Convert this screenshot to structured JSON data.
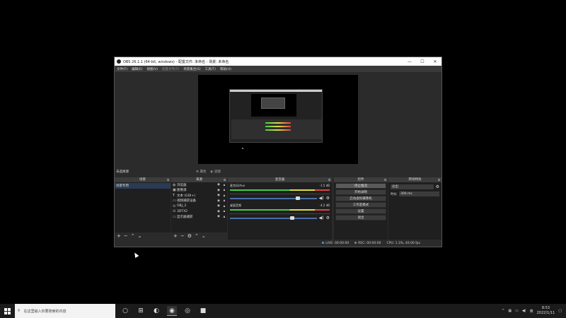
{
  "window": {
    "title": "OBS 26.1.1 (64-bit, windows) - 配置文件: 未命名 - 场景: 未命名",
    "controls": [
      "—",
      "☐",
      "✕"
    ]
  },
  "menu": [
    {
      "label": "文件(F)",
      "disabled": false
    },
    {
      "label": "编辑(E)",
      "disabled": false
    },
    {
      "label": "视图(V)",
      "disabled": false
    },
    {
      "label": "配置文件(P)",
      "disabled": true
    },
    {
      "label": "场景集合(S)",
      "disabled": false
    },
    {
      "label": "工具(T)",
      "disabled": false
    },
    {
      "label": "帮助(H)",
      "disabled": false
    }
  ],
  "preview_toolbar": {
    "selection_label": "未选择源",
    "properties_label": "属性",
    "filters_label": "滤镜"
  },
  "docks": {
    "scenes": {
      "title": "场景",
      "items": [
        "场景专用"
      ]
    },
    "sources": {
      "title": "来源",
      "items": [
        {
          "icon": "browser-icon",
          "glyph": "◍",
          "label": "浏览器"
        },
        {
          "icon": "image-icon",
          "glyph": "▣",
          "label": "图像源"
        },
        {
          "icon": "text-icon",
          "glyph": "T",
          "label": "文本 (GDI+)"
        },
        {
          "icon": "camera-icon",
          "glyph": "▭",
          "label": "视频捕获设备"
        },
        {
          "icon": "vr-icon",
          "glyph": "⊙",
          "label": "OBJ_3"
        },
        {
          "icon": "vr-icon",
          "glyph": "⊙",
          "label": "3DTX2"
        },
        {
          "icon": "monitor-icon",
          "glyph": "▭",
          "label": "显示器捕获"
        }
      ]
    },
    "mixer": {
      "title": "混音器",
      "channels": [
        {
          "name": "麦克风/Aux",
          "db": "-1.5 dB",
          "fader": 0.78
        },
        {
          "name": "桌面音频",
          "db": "-4.2 dB",
          "fader": 0.72
        }
      ]
    },
    "controls": {
      "title": "控件",
      "buttons": [
        "停止推流",
        "开始录制",
        "启动虚拟摄像机",
        "工作室模式",
        "设置",
        "退出"
      ]
    },
    "transitions": {
      "title": "转场特效",
      "type_value": "淡出",
      "duration_label": "时长",
      "duration_value": "300 ms"
    }
  },
  "statusbar": {
    "live": "LIVE: 00:00:00",
    "rec": "REC: 00:00:00",
    "cpu": "CPU: 1.3%, 40.00 fps"
  },
  "taskbar": {
    "search_placeholder": "在这里输入你要搜索的内容",
    "apps": [
      {
        "name": "task-view-icon",
        "glyph": "○",
        "running": false
      },
      {
        "name": "grid-icon",
        "glyph": "⊞",
        "running": false
      },
      {
        "name": "edge-icon",
        "glyph": "◐",
        "running": false
      },
      {
        "name": "obs-icon",
        "glyph": "◉",
        "running": true
      },
      {
        "name": "steam-icon",
        "glyph": "◎",
        "running": false
      },
      {
        "name": "app-red-icon",
        "glyph": "■",
        "running": false
      }
    ],
    "time": "8:53",
    "date": "2022/1/11"
  },
  "colors": {
    "accent": "#4a6ea8",
    "desktop": "#000000",
    "panel": "#2b2b2b"
  }
}
